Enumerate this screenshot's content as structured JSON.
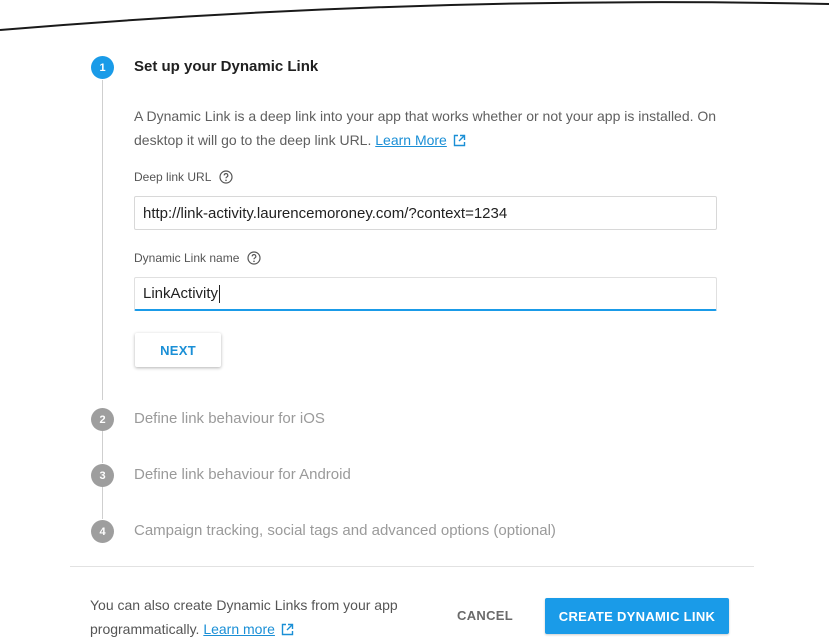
{
  "steps": [
    {
      "number": "1",
      "title": "Set up your Dynamic Link"
    },
    {
      "number": "2",
      "title": "Define link behaviour for iOS"
    },
    {
      "number": "3",
      "title": "Define link behaviour for Android"
    },
    {
      "number": "4",
      "title": "Campaign tracking, social tags and advanced options (optional)"
    }
  ],
  "step1": {
    "description": "A Dynamic Link is a deep link into your app that works whether or not your app is installed. On desktop it will go to the deep link URL.",
    "learn_more": "Learn More",
    "deep_link": {
      "label": "Deep link URL",
      "value": "http://link-activity.laurencemoroney.com/?context=1234"
    },
    "link_name": {
      "label": "Dynamic Link name",
      "value": "LinkActivity"
    },
    "next_label": "NEXT"
  },
  "footer": {
    "text": "You can also create Dynamic Links from your app programmatically.",
    "learn_more": "Learn more",
    "cancel_label": "CANCEL",
    "create_label": "CREATE DYNAMIC LINK"
  },
  "colors": {
    "accent": "#1a9be8",
    "link": "#1a8fd6",
    "inactive_step": "#9e9e9e"
  },
  "icons": {
    "external_link": "open-in-new-icon",
    "help": "help-circle-icon"
  }
}
